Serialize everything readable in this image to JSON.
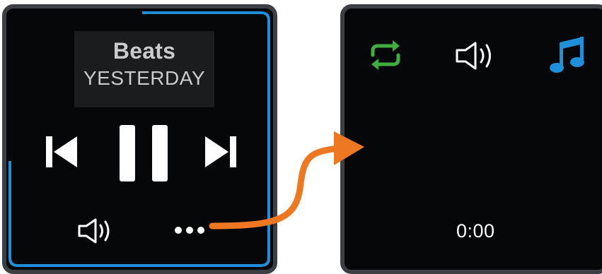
{
  "player": {
    "artist": "Beats",
    "track": "YESTERDAY",
    "controls": {
      "previous": "previous-track-icon",
      "pause": "pause-icon",
      "next": "next-track-icon",
      "volume": "volume-icon",
      "more": "more-options-icon"
    }
  },
  "options_screen": {
    "icons": [
      "repeat-icon",
      "volume-icon",
      "music-note-icon"
    ],
    "time": "0:00"
  },
  "colors": {
    "accent_blue": "#1e8fd8",
    "repeat_green": "#3fae3f",
    "arrow_orange": "#ee7722",
    "screen_bg": "#060708",
    "bezel": "#3c3f43"
  }
}
